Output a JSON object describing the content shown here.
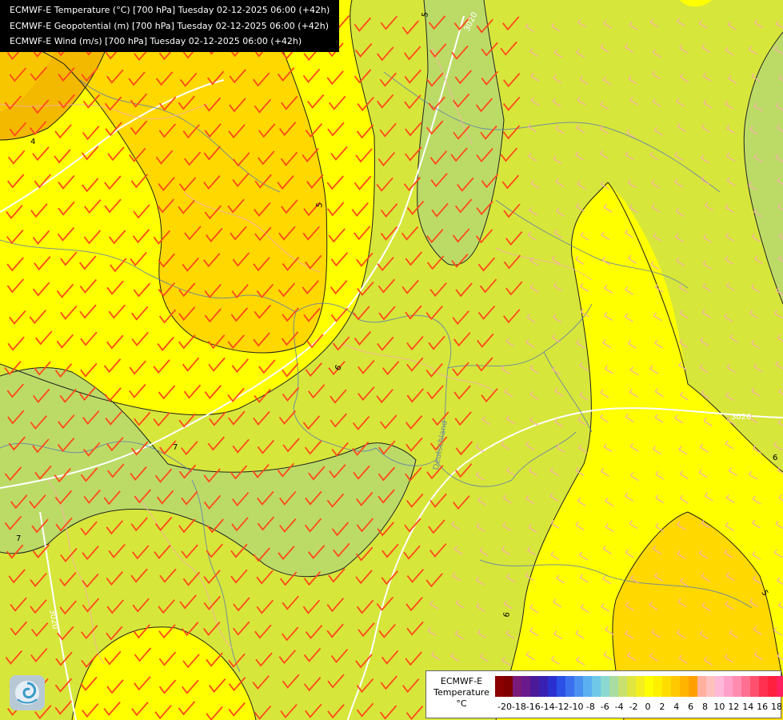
{
  "titles": [
    "ECMWF-E Temperature (°C) [700 hPa] Tuesday 02-12-2025 06:00 (+42h)",
    "ECMWF-E Geopotential (m) [700 hPa] Tuesday 02-12-2025 06:00 (+42h)",
    "ECMWF-E Wind (m/s) [700 hPa] Tuesday 02-12-2025 06:00 (+42h)"
  ],
  "legend": {
    "name": "ECMWF-E",
    "variable": "Temperature",
    "unit": "°C",
    "tick_labels": [
      "-20",
      "-18",
      "-16",
      "-14",
      "-12",
      "-10",
      "-8",
      "-6",
      "-4",
      "-2",
      "0",
      "2",
      "4",
      "6",
      "8",
      "10",
      "12",
      "14",
      "16",
      "18"
    ],
    "colors": [
      "#8b0000",
      "#800000",
      "#7a1a7a",
      "#6a1a8a",
      "#4b1a9a",
      "#3a20b0",
      "#2a30d0",
      "#2a50e8",
      "#3a70f0",
      "#4a90f0",
      "#5ab0f0",
      "#70c8e8",
      "#8ad8d0",
      "#a8dca0",
      "#c8e070",
      "#e0e640",
      "#f4ee20",
      "#ffff00",
      "#ffef00",
      "#ffdc00",
      "#ffc800",
      "#ffb400",
      "#ffa000",
      "#ffb0a0",
      "#ffc0c0",
      "#ffb8d8",
      "#ffa0c8",
      "#ff8cb0",
      "#ff7090",
      "#ff5070",
      "#ff3050",
      "#ff2040",
      "#ff2060",
      "#ff20a0",
      "#ff20c8",
      "#f020e0"
    ]
  },
  "map_labels": {
    "isotherms": [
      "4",
      "5",
      "6",
      "7",
      "7",
      "6",
      "5",
      "5",
      "6"
    ],
    "isohypse": "3020",
    "place": "Deutschland"
  },
  "region_colors": {
    "t4": "#f3b800",
    "t5": "#ffd800",
    "t6": "#ffff00",
    "t7": "#d7e63a",
    "t8": "#bcdb66",
    "barb": "#ff4a1a",
    "barb_light": "#f4b0a8",
    "border": "#5a7ab0"
  }
}
